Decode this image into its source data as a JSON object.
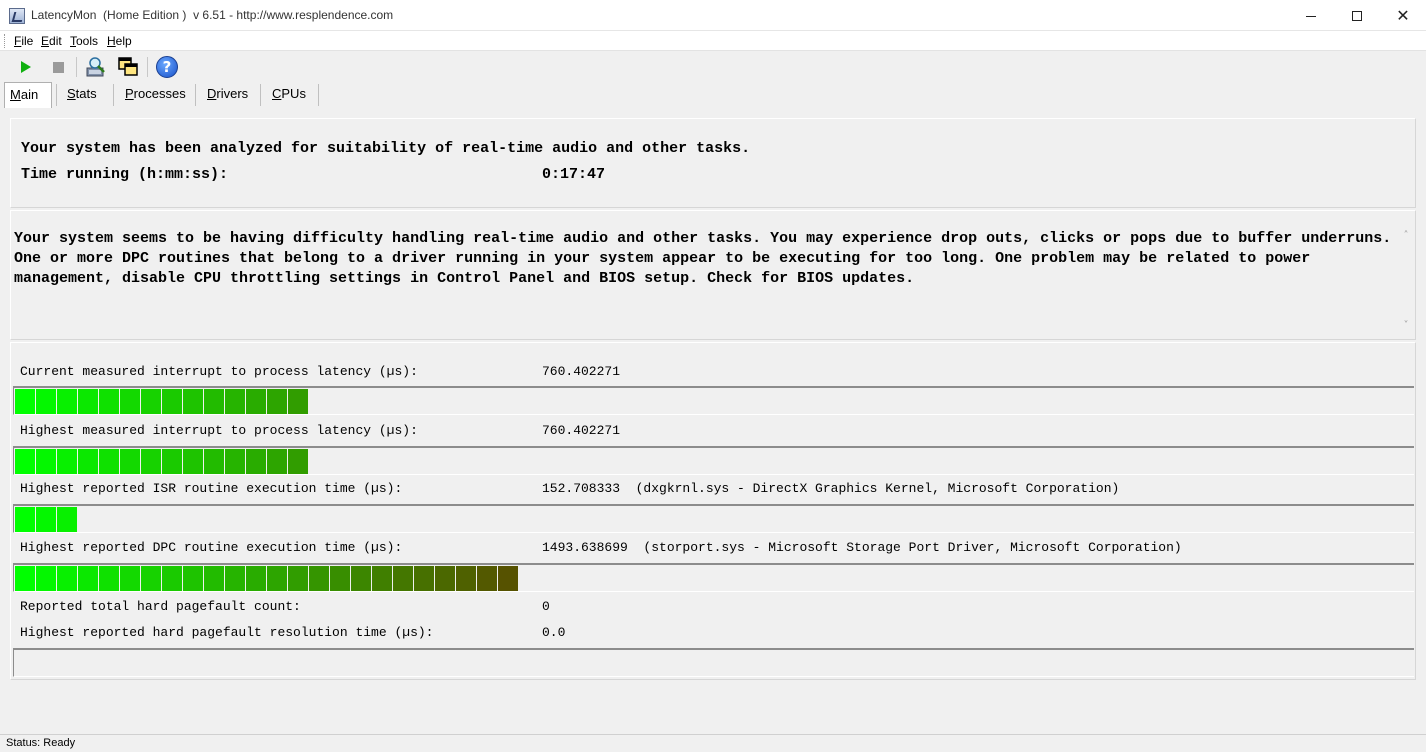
{
  "window": {
    "title": "LatencyMon  (Home Edition )  v 6.51 - http://www.resplendence.com",
    "minimize_glyph": "",
    "close_glyph": "✕"
  },
  "menu": [
    {
      "u": "F",
      "rest": "ile"
    },
    {
      "u": "E",
      "rest": "dit"
    },
    {
      "u": "T",
      "rest": "ools"
    },
    {
      "u": "H",
      "rest": "elp"
    }
  ],
  "toolbar": {
    "icons": [
      "play-icon",
      "stop-icon",
      "drivers-icon",
      "windows-icon",
      "help-icon"
    ],
    "help_glyph": "?"
  },
  "tabs": [
    {
      "u": "M",
      "rest": "ain",
      "active": true
    },
    {
      "u": "S",
      "rest": "tats",
      "active": false
    },
    {
      "u": "P",
      "rest": "rocesses",
      "active": false
    },
    {
      "u": "D",
      "rest": "rivers",
      "active": false
    },
    {
      "u": "C",
      "rest": "PUs",
      "active": false
    }
  ],
  "summary": {
    "line1": "Your system has been analyzed for suitability of real-time audio and other tasks.",
    "time_label": "Time running (h:mm:ss):",
    "time_value": "0:17:47"
  },
  "verdict": {
    "text": "Your system seems to be having difficulty handling real-time audio and other tasks. You may experience drop outs, clicks or pops due to buffer underruns. One or more DPC routines that belong to a driver running in your system appear to be executing for too long. One problem may be related to power management, disable CPU throttling settings in Control Panel and BIOS setup. Check for BIOS updates.",
    "scroll_up": "˄",
    "scroll_down": "˅"
  },
  "measurements": {
    "current_latency_label": "Current measured interrupt to process latency (µs):",
    "current_latency_value": "760.402271",
    "highest_latency_label": "Highest measured interrupt to process latency (µs):",
    "highest_latency_value": "760.402271",
    "isr_label": "Highest reported ISR routine execution time (µs):",
    "isr_value": "152.708333  (dxgkrnl.sys - DirectX Graphics Kernel, Microsoft Corporation)",
    "dpc_label": "Highest reported DPC routine execution time (µs):",
    "dpc_value": "1493.638699  (storport.sys - Microsoft Storage Port Driver, Microsoft Corporation)",
    "pagefault_count_label": "Reported total hard pagefault count:",
    "pagefault_count_value": "0",
    "pagefault_time_label": "Highest reported hard pagefault resolution time (µs):",
    "pagefault_time_value": "0.0"
  },
  "meters": {
    "current_latency_segments": 14,
    "highest_latency_segments": 14,
    "isr_segments": 3,
    "dpc_segments": 24,
    "pagefault_segments": 0,
    "color_start": "#00ff00",
    "color_end": "#5a4a00"
  },
  "status": {
    "text": "Status: Ready"
  }
}
